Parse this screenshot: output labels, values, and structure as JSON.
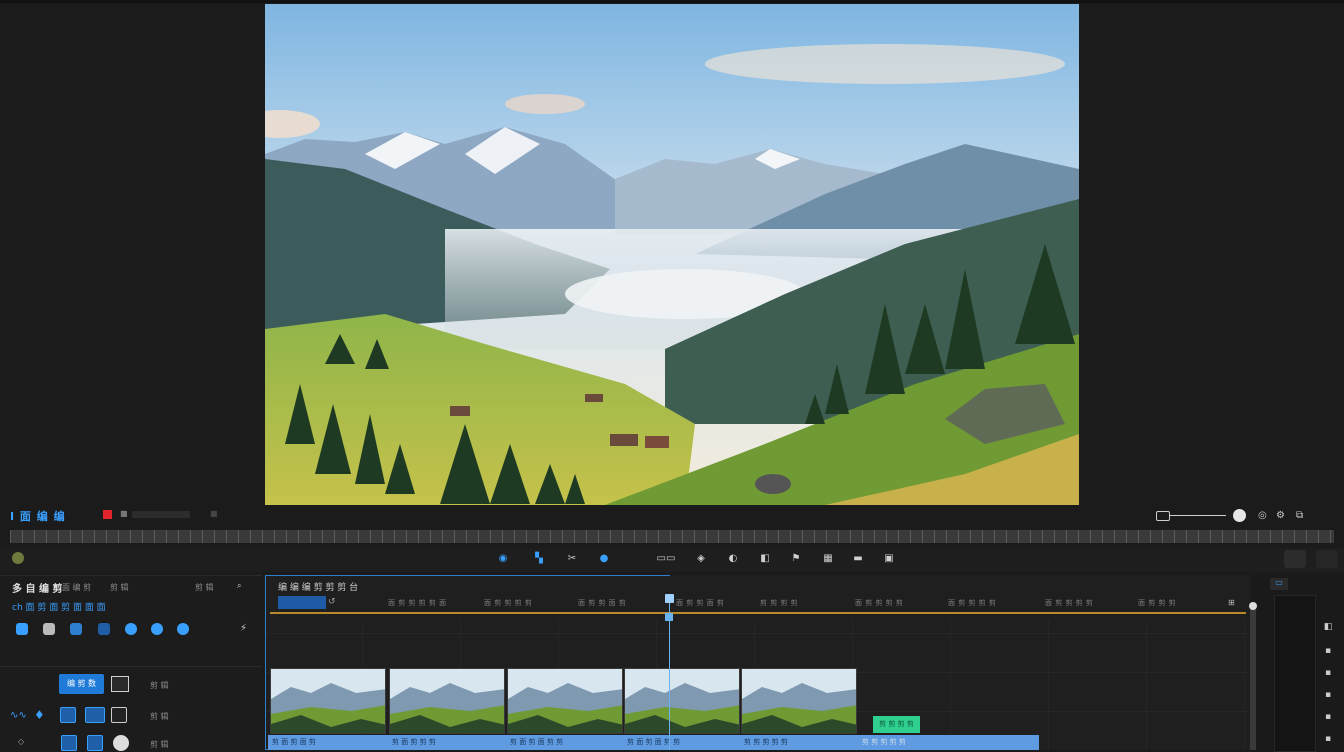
{
  "transport": {
    "timecode_label": "I 面 编 编",
    "small_a": "■",
    "small_b": "■"
  },
  "toolbar": {
    "icons": [
      "record-icon",
      "marker-icon",
      "cut-icon",
      "ripple-icon",
      "crop-icon",
      "mask-icon",
      "color-icon",
      "text-icon",
      "flag-icon",
      "grid-icon",
      "export-icon"
    ]
  },
  "left_panel": {
    "title": "多 自 编 剪",
    "tabs": [
      "面 编 剪",
      "剪 辑",
      "剪 辑"
    ],
    "subtitle": "ch 面 剪 面 剪 面 面 面",
    "btn_label": "编 剪 数",
    "row1_label": "剪 辑",
    "row2_label": "剪 辑",
    "row3_label": "剪 辑"
  },
  "timeline": {
    "header": "编 编 编 剪 剪 剪 台",
    "ticks": [
      "面 剪 剪 剪 剪 面",
      "面 剪 剪 剪 剪",
      "面 剪 剪 面 剪",
      "面 剪 剪 面 剪",
      "剪 剪 剪 剪",
      "面 剪 剪 剪 剪",
      "面 剪 剪 剪 剪",
      "面 剪 剪 剪 剪",
      "面 剪 剪 剪",
      "面 剪 剪 剪 剪"
    ],
    "audio_labels": [
      "剪 面 剪 面 剪",
      "剪 面 剪 剪 剪",
      "剪 面 剪 面 剪 剪",
      "剪 面 剪 面 剪 剪",
      "剪 剪 剪 剪 剪",
      "剪 剪 剪 剪 剪"
    ],
    "green_clip": "剪 剪 剪 剪"
  },
  "colors": {
    "accent": "#3aa0ff",
    "record": "#e2242a",
    "audio": "#5f9be0",
    "clip_green": "#2fcf8f",
    "ruler": "#b88a2a"
  }
}
